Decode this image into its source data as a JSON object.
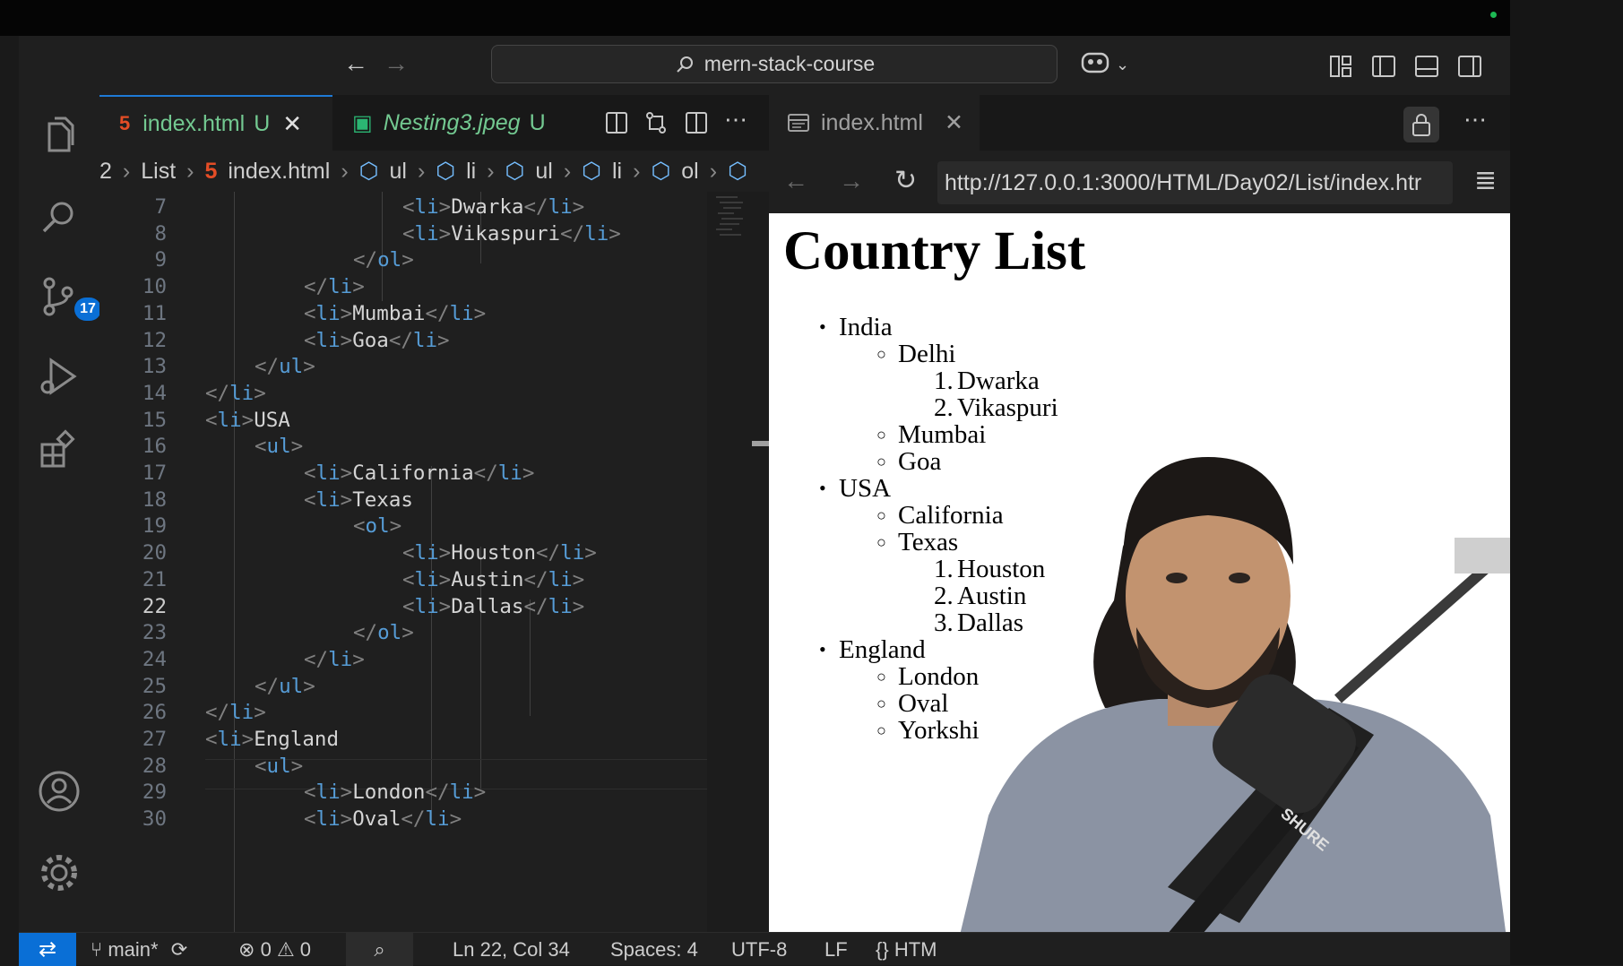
{
  "titlebar": {
    "search": "mern-stack-course"
  },
  "activity": {
    "source_control_badge": "17"
  },
  "editor_tabs": [
    {
      "label": "index.html",
      "status": "U"
    },
    {
      "label": "Nesting3.jpeg",
      "status": "U"
    }
  ],
  "breadcrumb": {
    "start": "2",
    "folder": "List",
    "file": "index.html",
    "nodes": [
      "ul",
      "li",
      "ul",
      "li",
      "ol"
    ]
  },
  "code": {
    "lines": [
      {
        "n": "7",
        "html": "<li>Dwarka</li>"
      },
      {
        "n": "8",
        "html": "<li>Vikaspuri</li>"
      },
      {
        "n": "9",
        "html": "</ol>"
      },
      {
        "n": "10",
        "html": "</li>"
      },
      {
        "n": "11",
        "html": "<li>Mumbai</li>"
      },
      {
        "n": "12",
        "html": "<li>Goa</li>"
      },
      {
        "n": "13",
        "html": "</ul>"
      },
      {
        "n": "14",
        "html": "</li>"
      },
      {
        "n": "15",
        "html": "<li>USA"
      },
      {
        "n": "16",
        "html": "<ul>"
      },
      {
        "n": "17",
        "html": "<li>California</li>"
      },
      {
        "n": "18",
        "html": "<li>Texas"
      },
      {
        "n": "19",
        "html": "<ol>"
      },
      {
        "n": "20",
        "html": "<li>Houston</li>"
      },
      {
        "n": "21",
        "html": "<li>Austin</li>"
      },
      {
        "n": "22",
        "html": "<li>Dallas</li>"
      },
      {
        "n": "23",
        "html": "</ol>"
      },
      {
        "n": "24",
        "html": "</li>"
      },
      {
        "n": "25",
        "html": "</ul>"
      },
      {
        "n": "26",
        "html": "</li>"
      },
      {
        "n": "27",
        "html": "<li>England"
      },
      {
        "n": "28",
        "html": "<ul>"
      },
      {
        "n": "29",
        "html": "<li>London</li>"
      },
      {
        "n": "30",
        "html": "<li>Oval</li>"
      }
    ],
    "current_line": "22"
  },
  "preview": {
    "tab_label": "index.html",
    "url": "http://127.0.0.1:3000/HTML/Day02/List/index.htr",
    "heading": "Country List",
    "list": [
      {
        "marker": "•",
        "text": "India"
      },
      {
        "marker": "○",
        "text": "Delhi"
      },
      {
        "marker": "1.",
        "text": "Dwarka"
      },
      {
        "marker": "2.",
        "text": "Vikaspuri"
      },
      {
        "marker": "○",
        "text": "Mumbai"
      },
      {
        "marker": "○",
        "text": "Goa"
      },
      {
        "marker": "•",
        "text": "USA"
      },
      {
        "marker": "○",
        "text": "California"
      },
      {
        "marker": "○",
        "text": "Texas"
      },
      {
        "marker": "1.",
        "text": "Houston"
      },
      {
        "marker": "2.",
        "text": "Austin"
      },
      {
        "marker": "3.",
        "text": "Dallas"
      },
      {
        "marker": "•",
        "text": "England"
      },
      {
        "marker": "○",
        "text": "London"
      },
      {
        "marker": "○",
        "text": "Oval"
      },
      {
        "marker": "○",
        "text": "Yorkshi"
      }
    ]
  },
  "statusbar": {
    "branch": "main*",
    "errors": "0",
    "warnings": "0",
    "position": "Ln 22, Col 34",
    "spaces": "Spaces: 4",
    "encoding": "UTF-8",
    "eol": "LF",
    "language": "HTM"
  },
  "overlay": {
    "mic_brand": "SHURE"
  },
  "colors": {
    "accent": "#1e7ad6",
    "html_icon": "#e44d26",
    "untracked": "#73c991",
    "tag": "#569cd6"
  }
}
